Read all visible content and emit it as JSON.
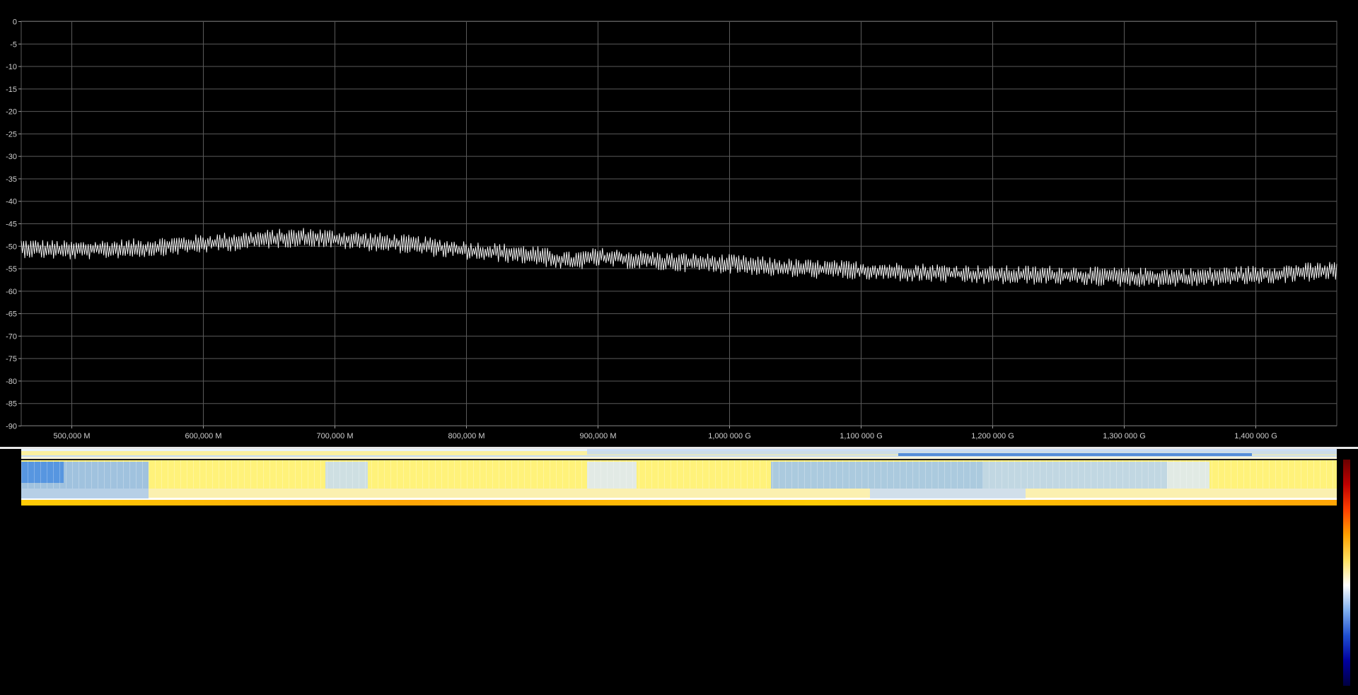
{
  "chart_data": {
    "type": "line",
    "title": "",
    "xlabel": "",
    "ylabel": "",
    "ylim": [
      -90,
      0
    ],
    "y_ticks": [
      "0",
      "-5",
      "-10",
      "-15",
      "-20",
      "-25",
      "-30",
      "-35",
      "-40",
      "-45",
      "-50",
      "-55",
      "-60",
      "-65",
      "-70",
      "-75",
      "-80",
      "-85",
      "-90"
    ],
    "y_tick_values": [
      0,
      -5,
      -10,
      -15,
      -20,
      -25,
      -30,
      -35,
      -40,
      -45,
      -50,
      -55,
      -60,
      -65,
      -70,
      -75,
      -80,
      -85,
      -90
    ],
    "xlim": [
      462000000,
      1462000000
    ],
    "x_ticks": [
      "500,000 M",
      "600,000 M",
      "700,000 M",
      "800,000 M",
      "900,000 M",
      "1,000 000 G",
      "1,100 000 G",
      "1,200 000 G",
      "1,300 000 G",
      "1,400 000 G"
    ],
    "x_tick_values": [
      500000000,
      600000000,
      700000000,
      800000000,
      900000000,
      1000000000,
      1100000000,
      1200000000,
      1300000000,
      1400000000
    ],
    "grid": true,
    "series": [
      {
        "x": [
          462000000,
          500000000,
          550000000,
          600000000,
          650000000,
          680000000,
          700000000,
          750000000,
          800000000,
          850000000,
          880000000,
          900000000,
          950000000,
          1000000000,
          1050000000,
          1100000000,
          1150000000,
          1200000000,
          1250000000,
          1300000000,
          1350000000,
          1400000000,
          1462000000
        ],
        "values": [
          -50.5,
          -51,
          -50.5,
          -49.5,
          -48.5,
          -48,
          -48.5,
          -49.5,
          -51,
          -52,
          -53.5,
          -52.5,
          -53.5,
          -54,
          -55,
          -55.5,
          -56,
          -56.5,
          -56.5,
          -57,
          -57,
          -56.5,
          -55.5
        ]
      }
    ],
    "line_color": "#ffffff",
    "grid_color": "#5a5a5a",
    "background": "#000000"
  },
  "waterfall": {
    "colormap": [
      "#000060",
      "#0010c0",
      "#3070e0",
      "#8ab8f0",
      "#ffffff",
      "#fff0a0",
      "#ffd000",
      "#ff9000",
      "#e82000",
      "#800000"
    ]
  },
  "colorbar": {
    "colors": [
      "#6a0000",
      "#c00000",
      "#ff4000",
      "#ffa000",
      "#ffe060",
      "#ffffff",
      "#80b0f0",
      "#2050d0",
      "#0000a0",
      "#000040"
    ]
  }
}
